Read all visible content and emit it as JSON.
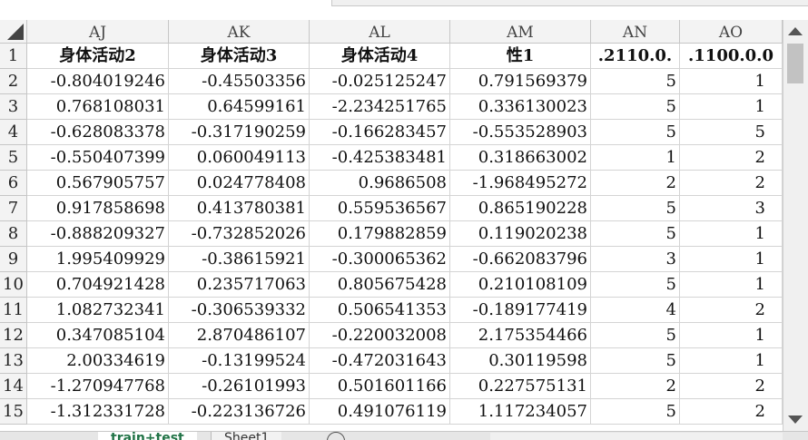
{
  "columns": [
    "AJ",
    "AK",
    "AL",
    "AM",
    "AN",
    "AO"
  ],
  "header_row": [
    "身体活动2",
    "身体活动3",
    "身体活动4",
    "性1",
    ".2110.0.",
    ".1100.0.0"
  ],
  "rows": [
    {
      "num": "2",
      "cells": [
        "-0.804019246",
        "-0.45503356",
        "-0.025125247",
        "0.791569379",
        "5",
        "1"
      ]
    },
    {
      "num": "3",
      "cells": [
        "0.768108031",
        "0.64599161",
        "-2.234251765",
        "0.336130023",
        "5",
        "1"
      ]
    },
    {
      "num": "4",
      "cells": [
        "-0.628083378",
        "-0.317190259",
        "-0.166283457",
        "-0.553528903",
        "5",
        "5"
      ]
    },
    {
      "num": "5",
      "cells": [
        "-0.550407399",
        "0.060049113",
        "-0.425383481",
        "0.318663002",
        "1",
        "2"
      ]
    },
    {
      "num": "6",
      "cells": [
        "0.567905757",
        "0.024778408",
        "0.9686508",
        "-1.968495272",
        "2",
        "2"
      ]
    },
    {
      "num": "7",
      "cells": [
        "0.917858698",
        "0.413780381",
        "0.559536567",
        "0.865190228",
        "5",
        "3"
      ]
    },
    {
      "num": "8",
      "cells": [
        "-0.888209327",
        "-0.732852026",
        "0.179882859",
        "0.119020238",
        "5",
        "1"
      ]
    },
    {
      "num": "9",
      "cells": [
        "1.995409929",
        "-0.38615921",
        "-0.300065362",
        "-0.662083796",
        "3",
        "1"
      ]
    },
    {
      "num": "10",
      "cells": [
        "0.704921428",
        "0.235717063",
        "0.805675428",
        "0.210108109",
        "5",
        "1"
      ]
    },
    {
      "num": "11",
      "cells": [
        "1.082732341",
        "-0.306539332",
        "0.506541353",
        "-0.189177419",
        "4",
        "2"
      ]
    },
    {
      "num": "12",
      "cells": [
        "0.347085104",
        "2.870486107",
        "-0.220032008",
        "2.175354466",
        "5",
        "1"
      ]
    },
    {
      "num": "13",
      "cells": [
        "2.00334619",
        "-0.13199524",
        "-0.472031643",
        "0.30119598",
        "5",
        "1"
      ]
    },
    {
      "num": "14",
      "cells": [
        "-1.270947768",
        "-0.26101993",
        "0.501601166",
        "0.227575131",
        "2",
        "2"
      ]
    },
    {
      "num": "15",
      "cells": [
        "-1.312331728",
        "-0.223136726",
        "0.491076119",
        "1.117234057",
        "5",
        "2"
      ]
    }
  ],
  "sheet_tabs": [
    {
      "label": "train+test",
      "active": true
    },
    {
      "label": "Sheet1",
      "active": false
    }
  ]
}
